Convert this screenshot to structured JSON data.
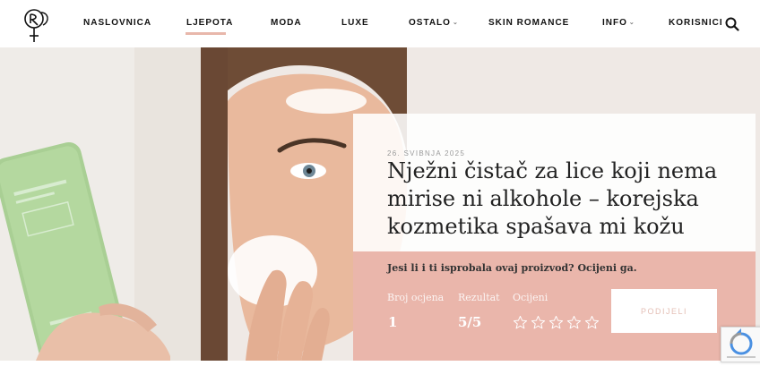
{
  "header": {
    "logo_name": "flower-logo",
    "nav": [
      {
        "label": "NASLOVNICA"
      },
      {
        "label": "LJEPOTA"
      },
      {
        "label": "MODA"
      },
      {
        "label": "LUXE"
      },
      {
        "label": "OSTALO"
      },
      {
        "label": "SKIN ROMANCE"
      },
      {
        "label": "INFO"
      },
      {
        "label": "KORISNICI"
      }
    ],
    "active_nav": "LJEPOTA",
    "search_icon": "search-icon"
  },
  "article": {
    "date": "26. SVIBNJA 2025",
    "title": "Nježni čistač za lice koji nema mirise ni alkohole – korejska kozmetika spašava mi kožu"
  },
  "rating": {
    "question": "Jesi li i ti isprobala ovaj proizvod? Ocijeni ga.",
    "count_label": "Broj ocjena",
    "count_value": "1",
    "result_label": "Rezultat",
    "result_value": "5/5",
    "rate_label": "Ocijeni",
    "stars_total": 5,
    "share_label": "PODIJELI"
  },
  "colors": {
    "accent": "#eab6ab",
    "active_underline": "#e8b7ab",
    "product_tube": "#a9cf94"
  }
}
